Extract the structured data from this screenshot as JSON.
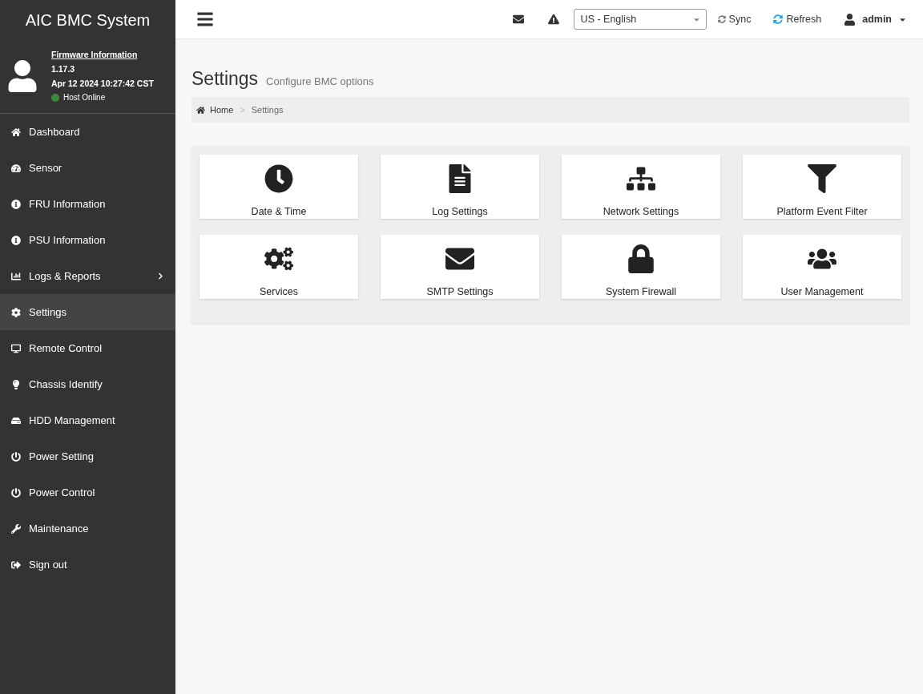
{
  "sidebar": {
    "title": "AIC BMC System",
    "firmware": {
      "link": "Firmware Information",
      "version": "1.17.3",
      "build_date": "Apr 12 2024 10:27:42 CST",
      "status": {
        "label": "Host Online",
        "color": "#3b8a3b"
      }
    },
    "items": [
      {
        "label": "Dashboard",
        "kind": "link",
        "selected": false
      },
      {
        "label": "Sensor",
        "kind": "link",
        "selected": false
      },
      {
        "label": "FRU Information",
        "kind": "link",
        "selected": false
      },
      {
        "label": "PSU Information",
        "kind": "link",
        "selected": false
      },
      {
        "label": "Logs & Reports",
        "kind": "group",
        "selected": false
      },
      {
        "label": "Settings",
        "kind": "link",
        "selected": true
      },
      {
        "label": "Remote Control",
        "kind": "link",
        "selected": false
      },
      {
        "label": "Chassis Identify",
        "kind": "link",
        "selected": false
      },
      {
        "label": "HDD Management",
        "kind": "link",
        "selected": false
      },
      {
        "label": "Power Setting",
        "kind": "link",
        "selected": false
      },
      {
        "label": "Power Control",
        "kind": "link",
        "selected": false
      },
      {
        "label": "Maintenance",
        "kind": "link",
        "selected": false
      },
      {
        "label": "Sign out",
        "kind": "link",
        "selected": false
      }
    ]
  },
  "topbar": {
    "language": "US - English",
    "sync": "Sync",
    "refresh": "Refresh",
    "user": "admin"
  },
  "page": {
    "title": "Settings",
    "subtitle": "Configure BMC options",
    "breadcrumb": [
      "Home",
      "Settings"
    ],
    "separator": ">"
  },
  "tiles": [
    {
      "label": "Date & Time"
    },
    {
      "label": "Log Settings"
    },
    {
      "label": "Network Settings"
    },
    {
      "label": "Platform Event Filter"
    },
    {
      "label": "Services"
    },
    {
      "label": "SMTP Settings"
    },
    {
      "label": "System Firewall"
    },
    {
      "label": "User Management"
    }
  ]
}
